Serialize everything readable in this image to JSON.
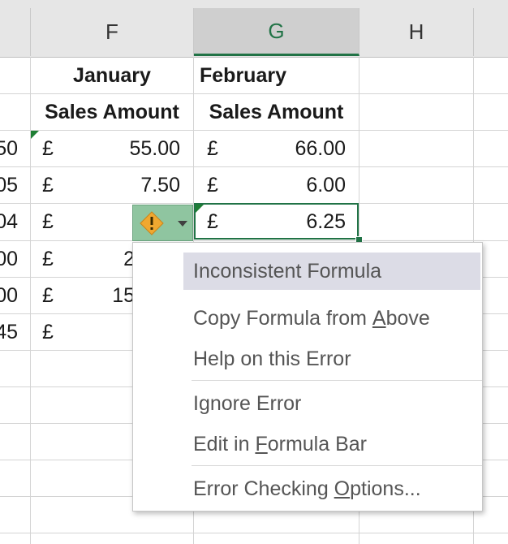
{
  "columns": [
    "F",
    "G",
    "H"
  ],
  "headers": {
    "f_row1": "January",
    "g_row1": "February",
    "f_row2": "Sales Amount",
    "g_row2": "Sales Amount"
  },
  "left_fragments": [
    "50",
    "05",
    "04",
    "00",
    "00",
    "45"
  ],
  "currency_symbol": "£",
  "f_values": [
    "55.00",
    "7.50",
    "",
    "2",
    "15",
    ""
  ],
  "g_values": [
    "66.00",
    "6.00",
    "6.25"
  ],
  "menu": {
    "title": "Inconsistent Formula",
    "items": [
      {
        "pre": "Copy Formula from ",
        "key": "A",
        "post": "bove"
      },
      {
        "pre": "Help on this Error",
        "key": "",
        "post": ""
      },
      {
        "pre": "Ignore Error",
        "key": "",
        "post": ""
      },
      {
        "pre": "Edit in ",
        "key": "F",
        "post": "ormula Bar"
      },
      {
        "pre": "Error Checking ",
        "key": "O",
        "post": "ptions..."
      }
    ]
  },
  "colors": {
    "accent_green": "#217346",
    "error_button": "#8fc5a0",
    "warning_diamond": "#f0a830",
    "menu_highlight": "#dcdce6"
  },
  "icons": {
    "error_button": "warning-diamond-icon",
    "dropdown": "chevron-down-icon"
  }
}
